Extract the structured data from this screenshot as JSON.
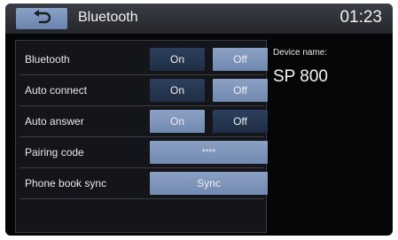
{
  "header": {
    "title": "Bluetooth",
    "clock": "01:23",
    "back_icon": "return-arrow-icon"
  },
  "settings": [
    {
      "label": "Bluetooth",
      "on": "On",
      "off": "Off",
      "selected": "On"
    },
    {
      "label": "Auto connect",
      "on": "On",
      "off": "Off",
      "selected": "On"
    },
    {
      "label": "Auto answer",
      "on": "On",
      "off": "Off",
      "selected": "Off"
    }
  ],
  "pairing": {
    "label": "Pairing code",
    "value": "****"
  },
  "phonebook": {
    "label": "Phone book sync",
    "button": "Sync"
  },
  "device": {
    "label": "Device name:",
    "name": "SP 800"
  },
  "colors": {
    "selected": "#223450",
    "unselected": "#7f96bd",
    "background": "#050608"
  }
}
